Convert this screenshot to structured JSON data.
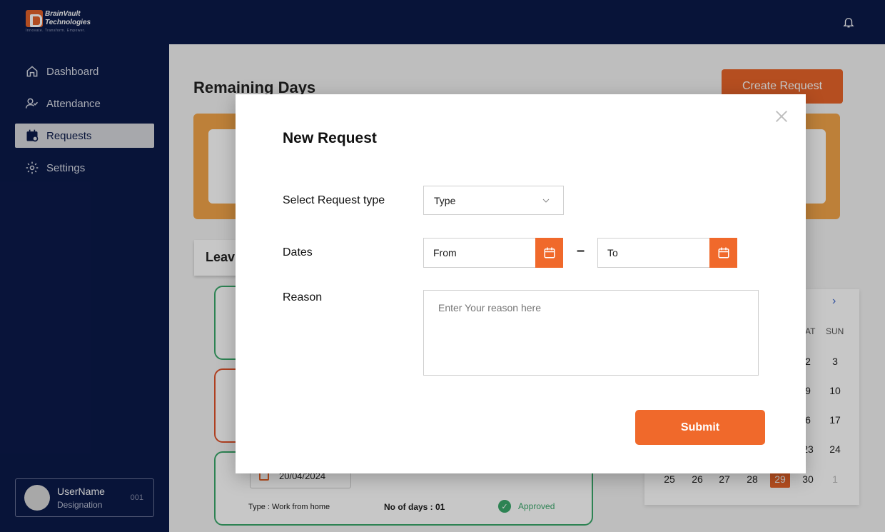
{
  "app": {
    "logo_line1": "BrainVault",
    "logo_line2": "Technologies",
    "logo_tagline": "Innovate. Transform. Empower."
  },
  "sidebar": {
    "items": [
      {
        "label": "Dashboard",
        "icon": "home-icon"
      },
      {
        "label": "Attendance",
        "icon": "user-check-icon"
      },
      {
        "label": "Requests",
        "icon": "calendar-icon",
        "active": true
      },
      {
        "label": "Settings",
        "icon": "gear-icon"
      }
    ],
    "user": {
      "name": "UserName",
      "designation": "Designation",
      "id": "001"
    }
  },
  "page": {
    "title": "Remaining  Days",
    "create_button": "Create Request",
    "leave_section_title": "Leav",
    "leave_card": {
      "date": "20/04/2024",
      "type": "Type : Work from home",
      "days": "No of days : 01",
      "status": "Approved"
    }
  },
  "calendar": {
    "weekday_partial": "AT",
    "weekday_sun": "SUN",
    "rows": [
      [
        "2",
        "3"
      ],
      [
        "9",
        "10"
      ],
      [
        "6",
        "17"
      ],
      [
        "23",
        "24"
      ]
    ],
    "last_row": [
      "25",
      "26",
      "27",
      "28",
      "29",
      "30",
      "1"
    ],
    "selected": "29"
  },
  "modal": {
    "title": "New Request",
    "type_label": "Select Request type",
    "type_value": "Type",
    "dates_label": "Dates",
    "from_value": "From",
    "separator": "–",
    "to_value": "To",
    "reason_label": "Reason",
    "reason_placeholder": "Enter Your reason here",
    "submit_label": "Submit"
  },
  "colors": {
    "navy": "#0b1a4a",
    "accent": "#f0692b",
    "approved": "#3aa86b"
  }
}
